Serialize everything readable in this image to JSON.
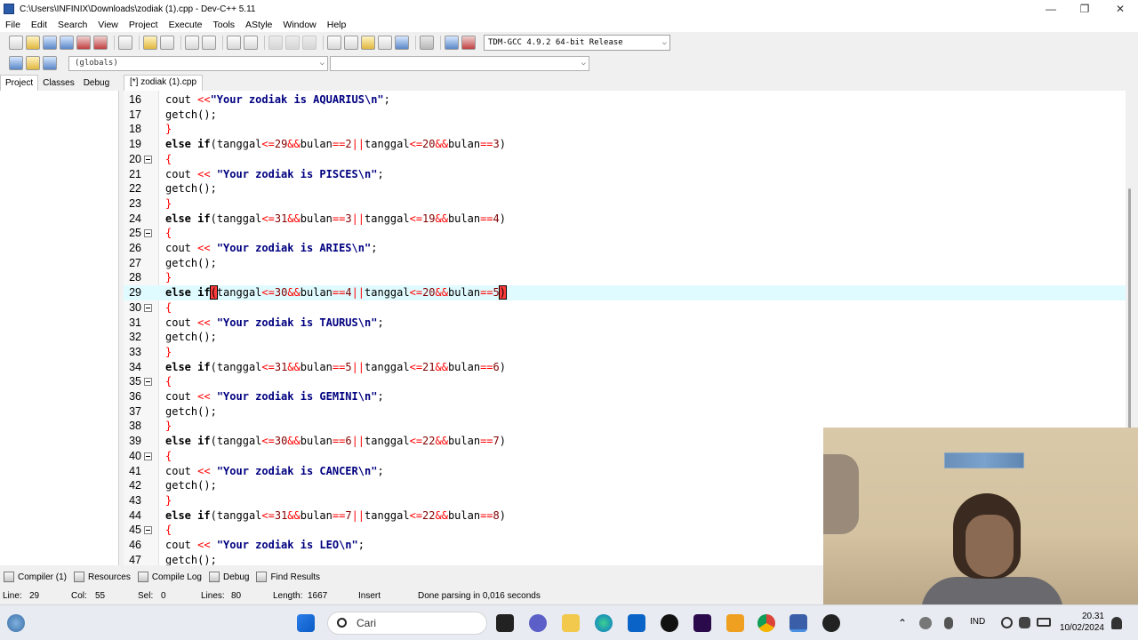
{
  "window": {
    "title": "C:\\Users\\INFINIX\\Downloads\\zodiak (1).cpp - Dev-C++ 5.11",
    "min": "—",
    "max": "❐",
    "close": "✕"
  },
  "menu": [
    "File",
    "Edit",
    "Search",
    "View",
    "Project",
    "Execute",
    "Tools",
    "AStyle",
    "Window",
    "Help"
  ],
  "toolbar": {
    "compiler": "TDM-GCC 4.9.2 64-bit Release"
  },
  "toolbar2": {
    "scope": "(globals)",
    "members": ""
  },
  "left_tabs": [
    "Project",
    "Classes",
    "Debug"
  ],
  "file_tab": "[*] zodiak (1).cpp",
  "editor": {
    "current_line": 29,
    "lines": [
      {
        "n": 16,
        "fold": false,
        "code": "cout <<\"Your zodiak is AQUARIUS\\n\";"
      },
      {
        "n": 17,
        "fold": false,
        "code": "getch();"
      },
      {
        "n": 18,
        "fold": false,
        "code": "}"
      },
      {
        "n": 19,
        "fold": false,
        "code": "else if(tanggal<=29&&bulan==2||tanggal<=20&&bulan==3)"
      },
      {
        "n": 20,
        "fold": true,
        "code": "{"
      },
      {
        "n": 21,
        "fold": false,
        "code": "cout << \"Your zodiak is PISCES\\n\";"
      },
      {
        "n": 22,
        "fold": false,
        "code": "getch();"
      },
      {
        "n": 23,
        "fold": false,
        "code": "}"
      },
      {
        "n": 24,
        "fold": false,
        "code": "else if(tanggal<=31&&bulan==3||tanggal<=19&&bulan==4)"
      },
      {
        "n": 25,
        "fold": true,
        "code": "{"
      },
      {
        "n": 26,
        "fold": false,
        "code": "cout << \"Your zodiak is ARIES\\n\";"
      },
      {
        "n": 27,
        "fold": false,
        "code": "getch();"
      },
      {
        "n": 28,
        "fold": false,
        "code": "}"
      },
      {
        "n": 29,
        "fold": false,
        "code": "else if(tanggal<=30&&bulan==4||tanggal<=20&&bulan==5)"
      },
      {
        "n": 30,
        "fold": true,
        "code": "{"
      },
      {
        "n": 31,
        "fold": false,
        "code": "cout << \"Your zodiak is TAURUS\\n\";"
      },
      {
        "n": 32,
        "fold": false,
        "code": "getch();"
      },
      {
        "n": 33,
        "fold": false,
        "code": "}"
      },
      {
        "n": 34,
        "fold": false,
        "code": "else if(tanggal<=31&&bulan==5||tanggal<=21&&bulan==6)"
      },
      {
        "n": 35,
        "fold": true,
        "code": "{"
      },
      {
        "n": 36,
        "fold": false,
        "code": "cout << \"Your zodiak is GEMINI\\n\";"
      },
      {
        "n": 37,
        "fold": false,
        "code": "getch();"
      },
      {
        "n": 38,
        "fold": false,
        "code": "}"
      },
      {
        "n": 39,
        "fold": false,
        "code": "else if(tanggal<=30&&bulan==6||tanggal<=22&&bulan==7)"
      },
      {
        "n": 40,
        "fold": true,
        "code": "{"
      },
      {
        "n": 41,
        "fold": false,
        "code": "cout << \"Your zodiak is CANCER\\n\";"
      },
      {
        "n": 42,
        "fold": false,
        "code": "getch();"
      },
      {
        "n": 43,
        "fold": false,
        "code": "}"
      },
      {
        "n": 44,
        "fold": false,
        "code": "else if(tanggal<=31&&bulan==7||tanggal<=22&&bulan==8)"
      },
      {
        "n": 45,
        "fold": true,
        "code": "{"
      },
      {
        "n": 46,
        "fold": false,
        "code": "cout << \"Your zodiak is LEO\\n\";"
      },
      {
        "n": 47,
        "fold": false,
        "code": "getch();"
      }
    ]
  },
  "bottom_tabs": [
    "Compiler (1)",
    "Resources",
    "Compile Log",
    "Debug",
    "Find Results"
  ],
  "status": {
    "line_label": "Line:",
    "line": "29",
    "col_label": "Col:",
    "col": "55",
    "sel_label": "Sel:",
    "sel": "0",
    "lines_label": "Lines:",
    "lines": "80",
    "length_label": "Length:",
    "length": "1667",
    "mode": "Insert",
    "message": "Done parsing in 0,016 seconds"
  },
  "taskbar": {
    "search_placeholder": "Cari",
    "lang": "IND",
    "time": "20.31",
    "date": "10/02/2024"
  },
  "colors": {
    "current_line": "#e0fbff",
    "string": "#000080",
    "symbol": "#ff0000",
    "number": "#800000"
  }
}
